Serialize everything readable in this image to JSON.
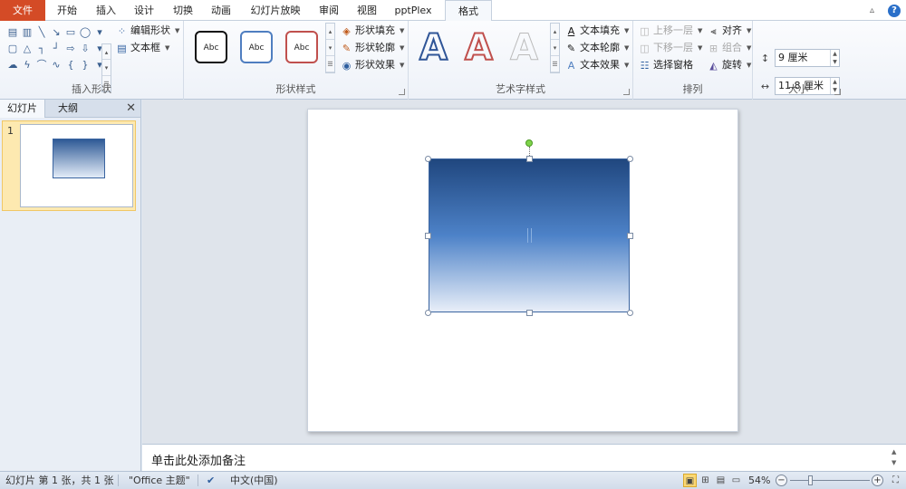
{
  "tabs": {
    "file": "文件",
    "items": [
      "开始",
      "插入",
      "设计",
      "切换",
      "动画",
      "幻灯片放映",
      "审阅",
      "视图",
      "pptPlex",
      "格式"
    ],
    "active": "格式"
  },
  "ribbon": {
    "insert_shapes": {
      "label": "插入形状",
      "edit_shape": "编辑形状",
      "text_box": "文本框"
    },
    "shape_styles": {
      "label": "形状样式",
      "abc": "Abc",
      "fill": "形状填充",
      "outline": "形状轮廓",
      "effects": "形状效果"
    },
    "wordart_styles": {
      "label": "艺术字样式",
      "glyph": "A",
      "text_fill": "文本填充",
      "text_outline": "文本轮廓",
      "text_effects": "文本效果"
    },
    "arrange": {
      "label": "排列",
      "bring_forward": "上移一层",
      "send_backward": "下移一层",
      "selection_pane": "选择窗格",
      "align": "对齐",
      "group": "组合",
      "rotate": "旋转"
    },
    "size": {
      "label": "大小",
      "height": "9 厘米",
      "width": "11.8 厘米"
    }
  },
  "left_panel": {
    "tab_slides": "幻灯片",
    "tab_outline": "大纲",
    "slide_number": "1"
  },
  "notes": {
    "placeholder": "单击此处添加备注"
  },
  "status": {
    "slide_info": "幻灯片 第 1 张，共 1 张",
    "theme": "\"Office 主题\"",
    "language": "中文(中国)",
    "zoom": "54%"
  },
  "colors": {
    "file_tab": "#d44b26",
    "shape_gradient_top": "#20477f",
    "shape_gradient_bottom": "#e8eef8"
  }
}
